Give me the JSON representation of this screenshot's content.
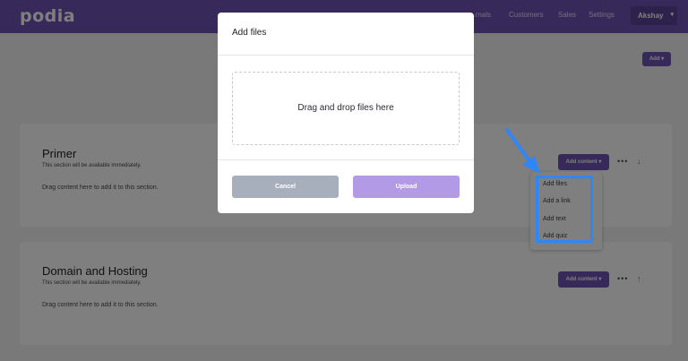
{
  "app": {
    "logo": "podia",
    "nav": [
      "...rnals",
      "Customers",
      "Sales",
      "Settings"
    ],
    "account": "Akshay"
  },
  "toolbar": {
    "add_label": "Add ▾"
  },
  "sections": [
    {
      "title": "Primer",
      "availability": "This section will be available immediately.",
      "drag_hint": "Drag content here to add it to this section.",
      "add_content_label": "Add content ▾",
      "more_icon": "ellipsis-icon",
      "move_icon": "arrow-down-icon"
    },
    {
      "title": "Domain and Hosting",
      "availability": "This section will be available immediately.",
      "drag_hint": "Drag content here to add it to this section.",
      "add_content_label": "Add content ▾",
      "more_icon": "ellipsis-icon",
      "move_icon": "arrow-up-icon"
    }
  ],
  "dropdown": {
    "items": [
      "Add files",
      "Add a link",
      "Add text",
      "Add quiz"
    ],
    "highlight_color": "#2f86f6"
  },
  "modal": {
    "title": "Add files",
    "dropzone_text": "Drag and drop files here",
    "cancel_label": "Cancel",
    "upload_label": "Upload"
  },
  "colors": {
    "brand": "#6e55b6",
    "upload_button": "#b29ae6",
    "cancel_button": "#a7afbd",
    "annotation": "#2f86f6"
  }
}
